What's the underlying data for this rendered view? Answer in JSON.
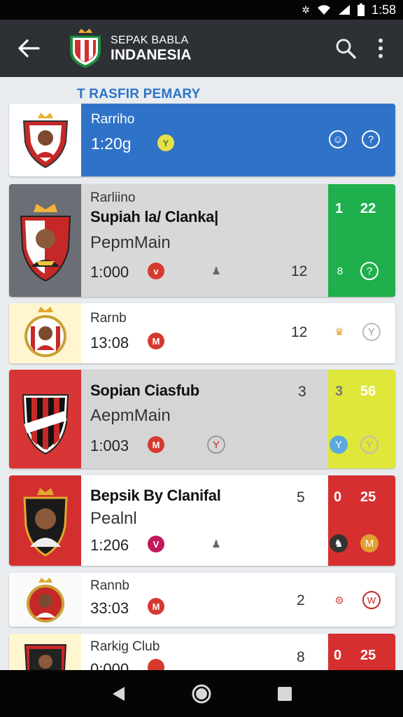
{
  "status_bar": {
    "time": "1:58",
    "icons": [
      "nfc-icon",
      "wifi-icon",
      "signal-icon",
      "battery-icon"
    ]
  },
  "app_bar": {
    "title_line1": "SEPAK BABLA",
    "title_line2": "INDANESIA",
    "icons": [
      "back-arrow-icon",
      "club-logo-icon",
      "search-icon",
      "more-vert-icon"
    ]
  },
  "section": {
    "title": "T RASFIR PEMARY"
  },
  "cards": [
    {
      "label": "Rarriho",
      "time": "1:20g",
      "time_badge": "Y",
      "right_icons": [
        "☺",
        "?"
      ],
      "colors": {
        "background": "#2f73c8",
        "crest_bg": "#ffffff"
      }
    },
    {
      "label": "Rarliino",
      "title": "Supiah la/ Clanka|",
      "subtitle": "PepmMain",
      "time": "1:000",
      "badge": "v",
      "mid_icon": "♟",
      "count": "12",
      "side_top": [
        "1",
        "22"
      ],
      "side_bottom": [
        "8",
        "?"
      ],
      "colors": {
        "background": "#d8d8d8",
        "side": "#1fb04d",
        "crest_bg": "#6b6e74"
      }
    },
    {
      "label": "Rarnb",
      "time": "13:08",
      "badge": "M",
      "count": "12",
      "right_icons": [
        "♛",
        "Y"
      ],
      "colors": {
        "background": "#ffffff",
        "crest_bg": "#fff6cf"
      }
    },
    {
      "title": "Sopian Ciasfub",
      "subtitle": "AepmMain",
      "time": "1:003",
      "badge": "M",
      "mid_icon": "Y",
      "count": "3",
      "side_top": [
        "3",
        "56"
      ],
      "side_bottom": [
        "Y",
        "Y"
      ],
      "colors": {
        "background": "#d5d5d5",
        "side": "#dfe83a",
        "crest_bg": "#d73536"
      }
    },
    {
      "title": "Bepsik By Clanifal",
      "subtitle": "Pealnl",
      "time": "1:206",
      "badge": "V",
      "mid_icon": "♟",
      "count": "5",
      "side_top": [
        "0",
        "25"
      ],
      "side_bottom": [
        "♞",
        "M"
      ],
      "colors": {
        "background": "#ffffff",
        "side": "#d62f30",
        "crest_bg": "#d32f2f"
      }
    },
    {
      "label": "Rannb",
      "time": "33:03",
      "badge": "M",
      "count": "2",
      "right_icons": [
        "⊜",
        "W"
      ],
      "colors": {
        "background": "#ffffff",
        "crest_bg": "#fafafa"
      }
    },
    {
      "label": "Rarkig Club",
      "time": "0:000",
      "badge": "",
      "count": "8",
      "side_top": [
        "0",
        "25"
      ],
      "colors": {
        "background": "#ffffff",
        "side": "#d62f30",
        "crest_bg": "#fff6cf"
      }
    }
  ],
  "nav_bar": {
    "icons": [
      "back-triangle-icon",
      "home-circle-icon",
      "recents-square-icon"
    ]
  }
}
